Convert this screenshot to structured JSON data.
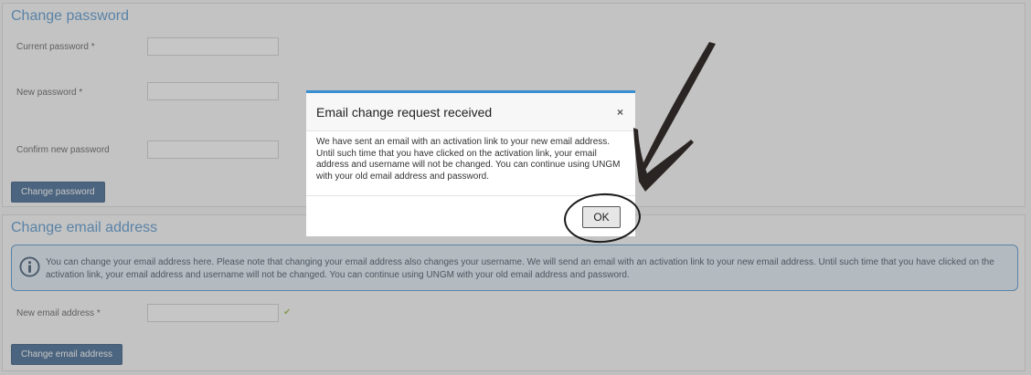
{
  "password_section": {
    "title": "Change password",
    "current_password_label": "Current password *",
    "new_password_label": "New password *",
    "confirm_password_label": "Confirm new password",
    "submit_label": "Change password"
  },
  "email_section": {
    "title": "Change email address",
    "info_text": "You can change your email address here. Please note that changing your email address also changes your username. We will send an email with an activation link to your new email address. Until such time that you have clicked on the activation link, your email address and username will not be changed. You can continue using UNGM with your old email address and password.",
    "new_email_label": "New email address *",
    "submit_label": "Change email address",
    "check_glyph": "✔"
  },
  "modal": {
    "title": "Email change request received",
    "close_glyph": "×",
    "body": "We have sent an email with an activation link to your new email address. Until such time that you have clicked on the activation link, your email address and username will not be changed. You can continue using UNGM with your old email address and password.",
    "ok_label": "OK"
  },
  "colors": {
    "accent": "#3a85c6",
    "button": "#1f4e7f",
    "info_bg": "#dde9f4",
    "modal_top_border": "#3a8fd0",
    "valid_check": "#8ab53a"
  },
  "icons": {
    "info": "info-icon",
    "close": "close-icon",
    "check": "check-icon",
    "annotation_arrow": "arrow-icon"
  }
}
